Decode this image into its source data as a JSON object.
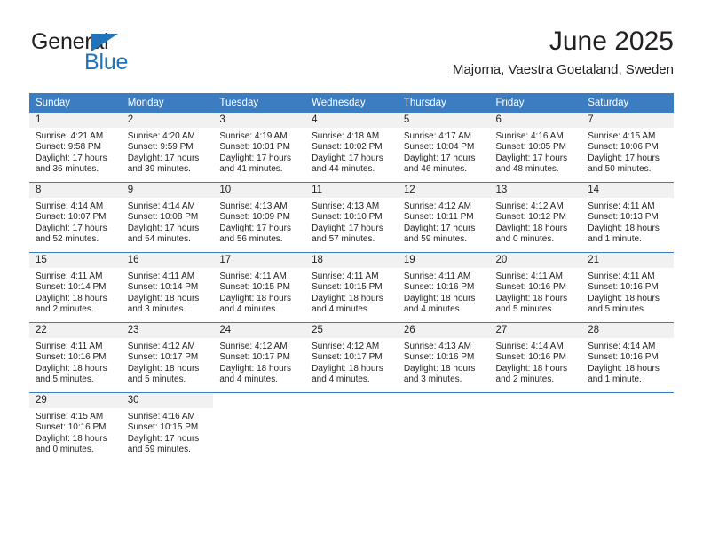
{
  "brand": {
    "name_part1": "General",
    "name_part2": "Blue",
    "accent_color": "#1f74bb"
  },
  "header": {
    "title": "June 2025",
    "subtitle": "Majorna, Vaestra Goetaland, Sweden"
  },
  "theme": {
    "header_blue": "#3b7dc0",
    "daynum_bg": "#f1f1f1",
    "text": "#231f20"
  },
  "weekday_headers": [
    "Sunday",
    "Monday",
    "Tuesday",
    "Wednesday",
    "Thursday",
    "Friday",
    "Saturday"
  ],
  "labels": {
    "sunrise_prefix": "Sunrise:",
    "sunset_prefix": "Sunset:",
    "daylight_prefix": "Daylight:"
  },
  "weeks": [
    [
      {
        "day": "1",
        "sunrise": "Sunrise: 4:21 AM",
        "sunset": "Sunset: 9:58 PM",
        "daylight": "Daylight: 17 hours and 36 minutes."
      },
      {
        "day": "2",
        "sunrise": "Sunrise: 4:20 AM",
        "sunset": "Sunset: 9:59 PM",
        "daylight": "Daylight: 17 hours and 39 minutes."
      },
      {
        "day": "3",
        "sunrise": "Sunrise: 4:19 AM",
        "sunset": "Sunset: 10:01 PM",
        "daylight": "Daylight: 17 hours and 41 minutes."
      },
      {
        "day": "4",
        "sunrise": "Sunrise: 4:18 AM",
        "sunset": "Sunset: 10:02 PM",
        "daylight": "Daylight: 17 hours and 44 minutes."
      },
      {
        "day": "5",
        "sunrise": "Sunrise: 4:17 AM",
        "sunset": "Sunset: 10:04 PM",
        "daylight": "Daylight: 17 hours and 46 minutes."
      },
      {
        "day": "6",
        "sunrise": "Sunrise: 4:16 AM",
        "sunset": "Sunset: 10:05 PM",
        "daylight": "Daylight: 17 hours and 48 minutes."
      },
      {
        "day": "7",
        "sunrise": "Sunrise: 4:15 AM",
        "sunset": "Sunset: 10:06 PM",
        "daylight": "Daylight: 17 hours and 50 minutes."
      }
    ],
    [
      {
        "day": "8",
        "sunrise": "Sunrise: 4:14 AM",
        "sunset": "Sunset: 10:07 PM",
        "daylight": "Daylight: 17 hours and 52 minutes."
      },
      {
        "day": "9",
        "sunrise": "Sunrise: 4:14 AM",
        "sunset": "Sunset: 10:08 PM",
        "daylight": "Daylight: 17 hours and 54 minutes."
      },
      {
        "day": "10",
        "sunrise": "Sunrise: 4:13 AM",
        "sunset": "Sunset: 10:09 PM",
        "daylight": "Daylight: 17 hours and 56 minutes."
      },
      {
        "day": "11",
        "sunrise": "Sunrise: 4:13 AM",
        "sunset": "Sunset: 10:10 PM",
        "daylight": "Daylight: 17 hours and 57 minutes."
      },
      {
        "day": "12",
        "sunrise": "Sunrise: 4:12 AM",
        "sunset": "Sunset: 10:11 PM",
        "daylight": "Daylight: 17 hours and 59 minutes."
      },
      {
        "day": "13",
        "sunrise": "Sunrise: 4:12 AM",
        "sunset": "Sunset: 10:12 PM",
        "daylight": "Daylight: 18 hours and 0 minutes."
      },
      {
        "day": "14",
        "sunrise": "Sunrise: 4:11 AM",
        "sunset": "Sunset: 10:13 PM",
        "daylight": "Daylight: 18 hours and 1 minute."
      }
    ],
    [
      {
        "day": "15",
        "sunrise": "Sunrise: 4:11 AM",
        "sunset": "Sunset: 10:14 PM",
        "daylight": "Daylight: 18 hours and 2 minutes."
      },
      {
        "day": "16",
        "sunrise": "Sunrise: 4:11 AM",
        "sunset": "Sunset: 10:14 PM",
        "daylight": "Daylight: 18 hours and 3 minutes."
      },
      {
        "day": "17",
        "sunrise": "Sunrise: 4:11 AM",
        "sunset": "Sunset: 10:15 PM",
        "daylight": "Daylight: 18 hours and 4 minutes."
      },
      {
        "day": "18",
        "sunrise": "Sunrise: 4:11 AM",
        "sunset": "Sunset: 10:15 PM",
        "daylight": "Daylight: 18 hours and 4 minutes."
      },
      {
        "day": "19",
        "sunrise": "Sunrise: 4:11 AM",
        "sunset": "Sunset: 10:16 PM",
        "daylight": "Daylight: 18 hours and 4 minutes."
      },
      {
        "day": "20",
        "sunrise": "Sunrise: 4:11 AM",
        "sunset": "Sunset: 10:16 PM",
        "daylight": "Daylight: 18 hours and 5 minutes."
      },
      {
        "day": "21",
        "sunrise": "Sunrise: 4:11 AM",
        "sunset": "Sunset: 10:16 PM",
        "daylight": "Daylight: 18 hours and 5 minutes."
      }
    ],
    [
      {
        "day": "22",
        "sunrise": "Sunrise: 4:11 AM",
        "sunset": "Sunset: 10:16 PM",
        "daylight": "Daylight: 18 hours and 5 minutes."
      },
      {
        "day": "23",
        "sunrise": "Sunrise: 4:12 AM",
        "sunset": "Sunset: 10:17 PM",
        "daylight": "Daylight: 18 hours and 5 minutes."
      },
      {
        "day": "24",
        "sunrise": "Sunrise: 4:12 AM",
        "sunset": "Sunset: 10:17 PM",
        "daylight": "Daylight: 18 hours and 4 minutes."
      },
      {
        "day": "25",
        "sunrise": "Sunrise: 4:12 AM",
        "sunset": "Sunset: 10:17 PM",
        "daylight": "Daylight: 18 hours and 4 minutes."
      },
      {
        "day": "26",
        "sunrise": "Sunrise: 4:13 AM",
        "sunset": "Sunset: 10:16 PM",
        "daylight": "Daylight: 18 hours and 3 minutes."
      },
      {
        "day": "27",
        "sunrise": "Sunrise: 4:14 AM",
        "sunset": "Sunset: 10:16 PM",
        "daylight": "Daylight: 18 hours and 2 minutes."
      },
      {
        "day": "28",
        "sunrise": "Sunrise: 4:14 AM",
        "sunset": "Sunset: 10:16 PM",
        "daylight": "Daylight: 18 hours and 1 minute."
      }
    ],
    [
      {
        "day": "29",
        "sunrise": "Sunrise: 4:15 AM",
        "sunset": "Sunset: 10:16 PM",
        "daylight": "Daylight: 18 hours and 0 minutes."
      },
      {
        "day": "30",
        "sunrise": "Sunrise: 4:16 AM",
        "sunset": "Sunset: 10:15 PM",
        "daylight": "Daylight: 17 hours and 59 minutes."
      },
      {
        "day": "",
        "sunrise": "",
        "sunset": "",
        "daylight": ""
      },
      {
        "day": "",
        "sunrise": "",
        "sunset": "",
        "daylight": ""
      },
      {
        "day": "",
        "sunrise": "",
        "sunset": "",
        "daylight": ""
      },
      {
        "day": "",
        "sunrise": "",
        "sunset": "",
        "daylight": ""
      },
      {
        "day": "",
        "sunrise": "",
        "sunset": "",
        "daylight": ""
      }
    ]
  ]
}
